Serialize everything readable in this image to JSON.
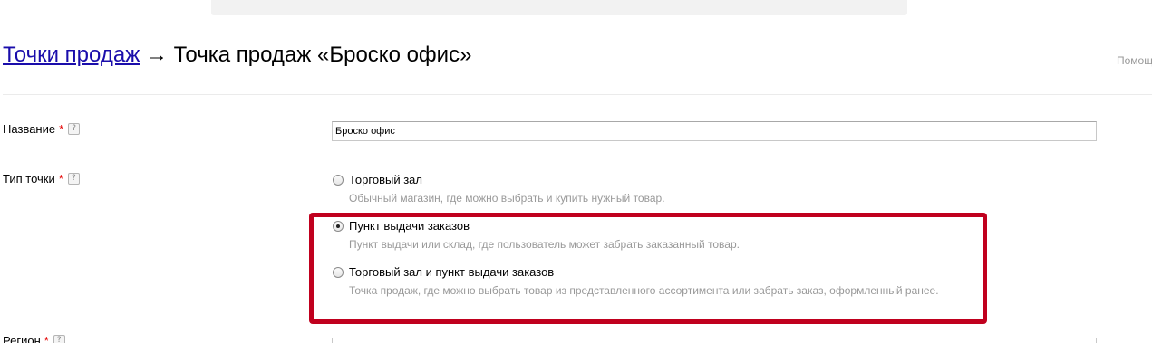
{
  "breadcrumb": {
    "parent_link": "Точки продаж",
    "arrow": " → ",
    "current": "Точка продаж «Броско офис»"
  },
  "help_link": "Помощ",
  "form": {
    "name": {
      "label": "Название",
      "required_mark": "*",
      "hint": "?",
      "value": "Броско офис"
    },
    "type": {
      "label": "Тип точки",
      "required_mark": "*",
      "hint": "?",
      "options": [
        {
          "label": "Торговый зал",
          "description": "Обычный магазин, где можно выбрать и купить нужный товар.",
          "checked": false
        },
        {
          "label": "Пункт выдачи заказов",
          "description": "Пункт выдачи или склад, где пользователь может забрать заказанный товар.",
          "checked": true
        },
        {
          "label": "Торговый зал и пункт выдачи заказов",
          "description": "Точка продаж, где можно выбрать товар из представленного ассортимента или забрать заказ, оформленный ранее.",
          "checked": false
        }
      ]
    },
    "region": {
      "label": "Регион",
      "required_mark": "*",
      "hint": "?"
    }
  },
  "colors": {
    "link": "#1a0dab",
    "required": "#e40000",
    "highlight": "#c0001e",
    "muted": "#999999"
  }
}
